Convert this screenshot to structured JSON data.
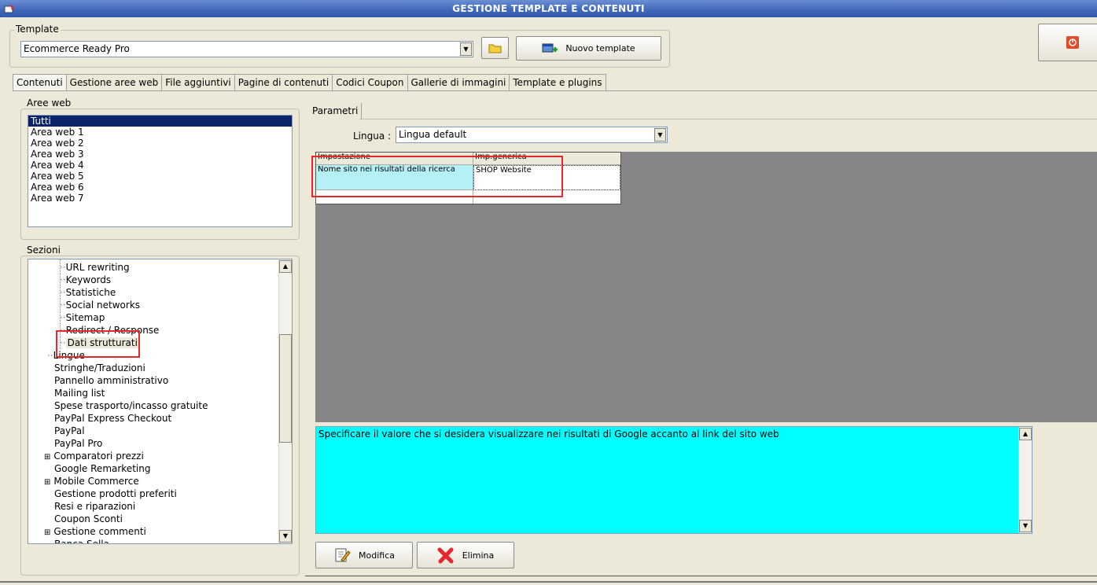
{
  "window": {
    "title": "GESTIONE TEMPLATE E CONTENUTI"
  },
  "template_group": {
    "label": "Template",
    "selected": "Ecommerce Ready Pro",
    "new_button": "Nuovo template"
  },
  "tabs": [
    {
      "label": "Contenuti",
      "active": true
    },
    {
      "label": "Gestione aree web",
      "active": false
    },
    {
      "label": "File aggiuntivi",
      "active": false
    },
    {
      "label": "Pagine di contenuti",
      "active": false
    },
    {
      "label": "Codici Coupon",
      "active": false
    },
    {
      "label": "Gallerie di immagini",
      "active": false
    },
    {
      "label": "Template e plugins",
      "active": false
    }
  ],
  "aree_web": {
    "label": "Aree web",
    "items": [
      "Tutti",
      "Area web 1",
      "Area web 2",
      "Area web 3",
      "Area web 4",
      "Area web 5",
      "Area web 6",
      "Area web 7"
    ],
    "selected_index": 0
  },
  "sezioni": {
    "label": "Sezioni",
    "items": [
      {
        "label": "URL rewriting",
        "level": 2
      },
      {
        "label": "Keywords",
        "level": 2
      },
      {
        "label": "Statistiche",
        "level": 2
      },
      {
        "label": "Social networks",
        "level": 2
      },
      {
        "label": "Sitemap",
        "level": 2
      },
      {
        "label": "Redirect / Response",
        "level": 2
      },
      {
        "label": "Dati strutturati",
        "level": 2,
        "selected": true
      },
      {
        "label": "Lingue",
        "level": 1
      },
      {
        "label": "Stringhe/Traduzioni",
        "level": 1
      },
      {
        "label": "Pannello amministrativo",
        "level": 1
      },
      {
        "label": "Mailing list",
        "level": 1
      },
      {
        "label": "Spese trasporto/incasso gratuite",
        "level": 1
      },
      {
        "label": "PayPal Express Checkout",
        "level": 1
      },
      {
        "label": "PayPal",
        "level": 1
      },
      {
        "label": "PayPal Pro",
        "level": 1
      },
      {
        "label": "Comparatori prezzi",
        "level": 1,
        "expandable": true
      },
      {
        "label": "Google Remarketing",
        "level": 1
      },
      {
        "label": "Mobile Commerce",
        "level": 1,
        "expandable": true
      },
      {
        "label": "Gestione prodotti preferiti",
        "level": 1
      },
      {
        "label": "Resi e riparazioni",
        "level": 1
      },
      {
        "label": "Coupon Sconti",
        "level": 1
      },
      {
        "label": "Gestione commenti",
        "level": 1,
        "expandable": true
      },
      {
        "label": "Banca Sella",
        "level": 1
      }
    ]
  },
  "parametri": {
    "tab_label": "Parametri",
    "lingua_label": "Lingua :",
    "lingua_selected": "Lingua default",
    "grid": {
      "headers": [
        "Impostazione",
        "Imp.generica"
      ],
      "rows": [
        [
          "Nome sito nei risultati della ricerca",
          "SHOP Website"
        ]
      ]
    },
    "description": "Specificare il valore che si desidera visualizzare nei risultati di Google accanto al link del sito web"
  },
  "actions": {
    "modify": "Modifica",
    "delete": "Elimina"
  },
  "colors": {
    "accent": "#0a246a",
    "highlight": "#e8262b",
    "description_bg": "#00ffff",
    "selected_cell": "#b4f0f5"
  }
}
